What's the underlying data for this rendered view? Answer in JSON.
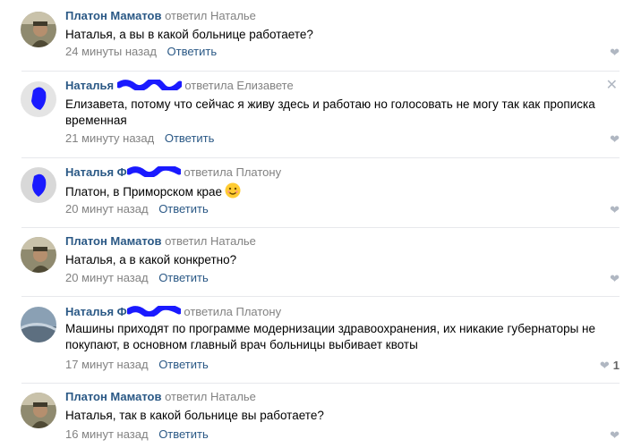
{
  "colors": {
    "link": "#2a5885",
    "muted": "#828282",
    "icon": "#b0b7c2",
    "redact": "#1a1aff"
  },
  "comments": [
    {
      "author": "Платон Маматов",
      "replied": "ответил Наталье",
      "text": "Наталья, а вы в какой больнице работаете?",
      "time": "24 минуты назад",
      "reply": "Ответить",
      "likes": ""
    },
    {
      "author": "Наталья",
      "replied": "ответила Елизавете",
      "text": "Елизавета, потому что сейчас я живу здесь и работаю но голосовать не могу так как прописка временная",
      "time": "21 минуту назад",
      "reply": "Ответить",
      "likes": ""
    },
    {
      "author": "Наталья Ф",
      "replied": "ответила Платону",
      "text": "Платон, в Приморском крае",
      "time": "20 минут назад",
      "reply": "Ответить",
      "likes": ""
    },
    {
      "author": "Платон Маматов",
      "replied": "ответил Наталье",
      "text": "Наталья, а в какой конкретно?",
      "time": "20 минут назад",
      "reply": "Ответить",
      "likes": ""
    },
    {
      "author": "Наталья Ф",
      "replied": "ответила Платону",
      "text": "Машины приходят по программе модернизации здравоохранения, их никакие губернаторы не покупают, в основном главный врач больницы выбивает квоты",
      "time": "17 минут назад",
      "reply": "Ответить",
      "likes": "1"
    },
    {
      "author": "Платон Маматов",
      "replied": "ответил Наталье",
      "text": "Наталья, так в какой больнице вы работаете?",
      "time": "16 минут назад",
      "reply": "Ответить",
      "likes": ""
    }
  ],
  "icons": {
    "like": "heart-icon",
    "close": "close-icon",
    "emoji": "smile-emoji-icon"
  }
}
